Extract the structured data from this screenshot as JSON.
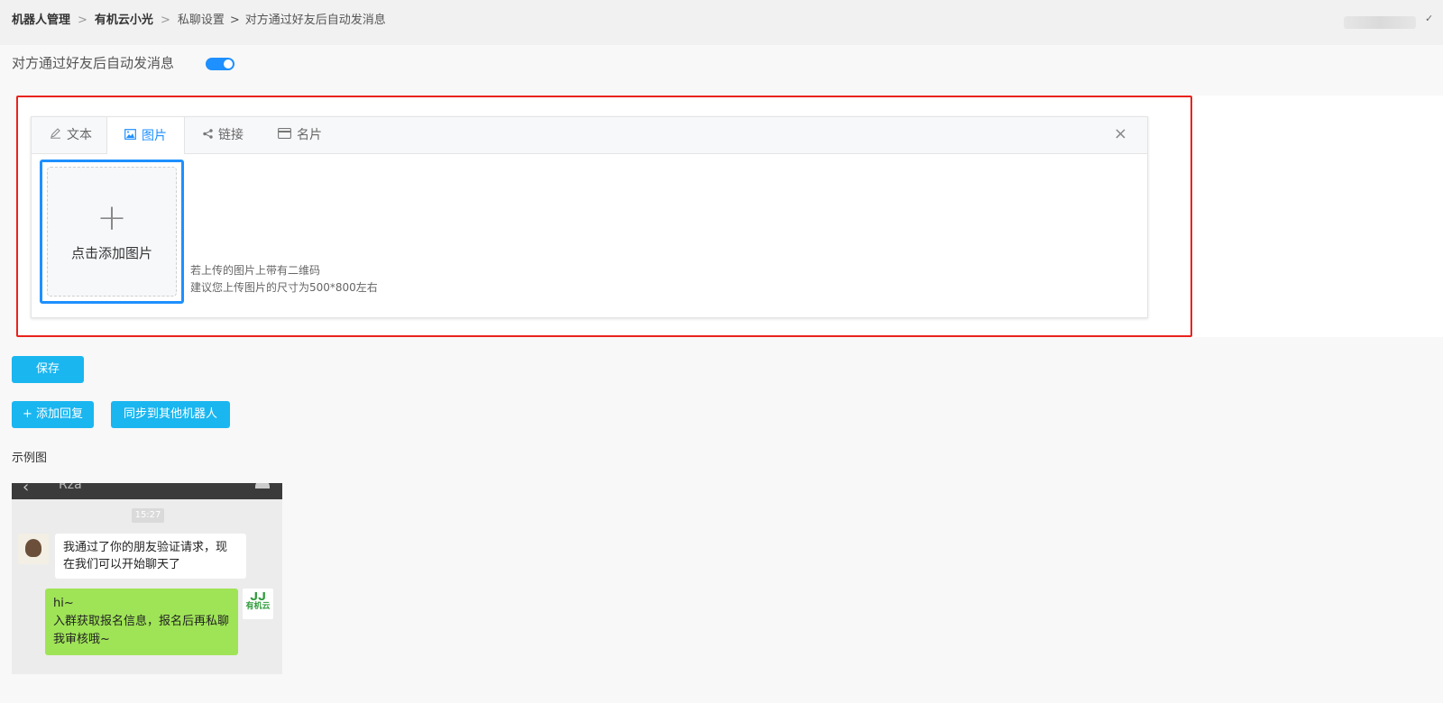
{
  "breadcrumb": {
    "items": [
      "机器人管理",
      "有机云小光",
      "私聊设置",
      "对方通过好友后自动发消息"
    ],
    "separators": [
      ">",
      ">",
      ">"
    ]
  },
  "toggle": {
    "label": "对方通过好友后自动发消息",
    "enabled": true,
    "color": "#1e90ff"
  },
  "editor": {
    "tabs": [
      {
        "label": "文本",
        "icon": "pencil-icon",
        "active": false
      },
      {
        "label": "图片",
        "icon": "image-icon",
        "active": true
      },
      {
        "label": "链接",
        "icon": "share-icon",
        "active": false
      },
      {
        "label": "名片",
        "icon": "card-icon",
        "active": false
      }
    ],
    "upload": {
      "plus": "+",
      "label": "点击添加图片"
    },
    "hints": [
      "若上传的图片上带有二维码",
      "建议您上传图片的尺寸为500*800左右"
    ],
    "close": "×"
  },
  "buttons": {
    "save": "保存",
    "add_reply": "+ 添加回复",
    "sync": "同步到其他机器人"
  },
  "example": {
    "label": "示例图",
    "time": "15:27",
    "chat_title": "Rza",
    "message_in": "我通过了你的朋友验证请求，现在我们可以开始聊天了",
    "message_out_lines": [
      "hi~",
      "入群获取报名信息，报名后再私聊我审核哦~"
    ],
    "logo_text": "有机云"
  },
  "colors": {
    "accent": "#1ab6f0",
    "highlight": "#e8231d",
    "bubble_green": "#9fe457"
  }
}
